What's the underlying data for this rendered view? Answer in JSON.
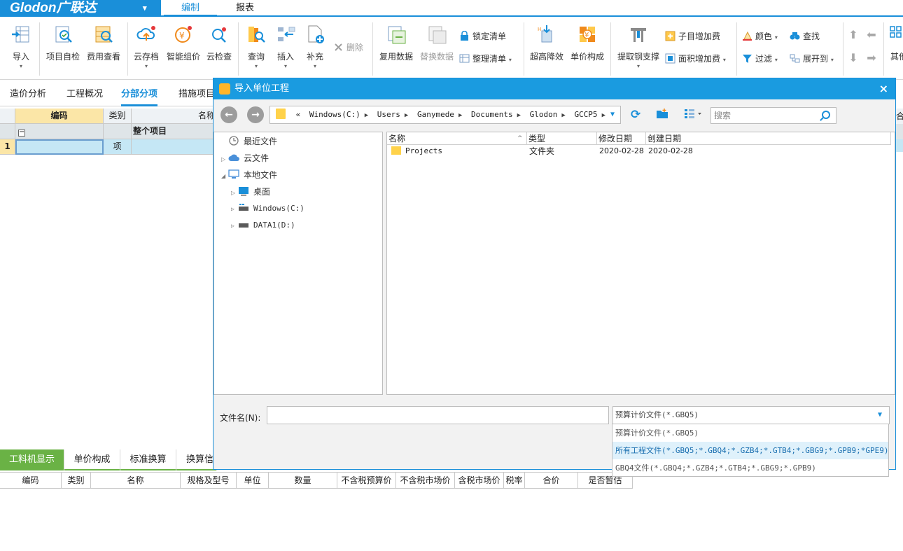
{
  "app": {
    "logo_text": "Glodon广联达",
    "logo_arrow": "▾"
  },
  "menu_tabs": [
    {
      "label": "编制",
      "active": true
    },
    {
      "label": "报表",
      "active": false
    }
  ],
  "ribbon": {
    "groups": [
      {
        "label": "导入",
        "icon": "import-icon",
        "dropdown": true
      },
      {
        "label": "项目自检",
        "icon": "self-check-icon"
      },
      {
        "label": "费用查看",
        "icon": "fee-view-icon"
      },
      {
        "label": "云存档",
        "icon": "cloud-save-icon",
        "dropdown": true
      },
      {
        "label": "智能组价",
        "icon": "smart-pricing-icon"
      },
      {
        "label": "云检查",
        "icon": "cloud-check-icon"
      },
      {
        "label": "查询",
        "icon": "query-icon",
        "dropdown": true
      },
      {
        "label": "插入",
        "icon": "insert-icon",
        "dropdown": true
      },
      {
        "label": "补充",
        "icon": "supplement-icon",
        "dropdown": true
      },
      {
        "label": "复用数据",
        "icon": "reuse-data-icon"
      },
      {
        "label": "替换数据",
        "icon": "replace-data-icon",
        "disabled": true
      },
      {
        "label": "超高降效",
        "icon": "high-efficiency-icon"
      },
      {
        "label": "单价构成",
        "icon": "unit-price-icon"
      },
      {
        "label": "提取钢支撑",
        "icon": "steel-support-icon",
        "dropdown": true
      },
      {
        "label": "其他",
        "icon": "other-icon"
      }
    ],
    "small_buttons": [
      {
        "label": "删除",
        "icon": "delete-icon",
        "disabled": true
      },
      {
        "label": "锁定清单",
        "icon": "lock-icon"
      },
      {
        "label": "整理清单",
        "icon": "organize-icon",
        "dropdown": true
      },
      {
        "label": "子目增加费",
        "icon": "item-fee-icon"
      },
      {
        "label": "面积增加费",
        "icon": "area-fee-icon",
        "dropdown": true
      },
      {
        "label": "颜色",
        "icon": "color-icon",
        "dropdown": true
      },
      {
        "label": "查找",
        "icon": "find-icon"
      },
      {
        "label": "过滤",
        "icon": "filter-icon",
        "dropdown": true
      },
      {
        "label": "展开到",
        "icon": "expand-icon",
        "dropdown": true
      }
    ]
  },
  "sub_tabs": [
    {
      "label": "造价分析"
    },
    {
      "label": "工程概况"
    },
    {
      "label": "分部分项",
      "active": true
    },
    {
      "label": "措施项目"
    }
  ],
  "main_grid": {
    "headers": {
      "code": "编码",
      "type": "类别",
      "name": "名称"
    },
    "rows": [
      {
        "index": "",
        "code": "",
        "type": "",
        "name": "整个项目"
      },
      {
        "index": "1",
        "code": "",
        "type": "项",
        "name": ""
      }
    ],
    "right_edge_text": "合计"
  },
  "bottom_tabs": [
    {
      "label": "工料机显示",
      "active": true
    },
    {
      "label": "单价构成"
    },
    {
      "label": "标准换算"
    },
    {
      "label": "换算信息"
    }
  ],
  "bottom_headers": [
    "编码",
    "类别",
    "名称",
    "规格及型号",
    "单位",
    "数量",
    "不含税预算价",
    "不含税市场价",
    "含税市场价",
    "税率",
    "合价",
    "是否暂估"
  ],
  "dialog": {
    "title": "导入单位工程",
    "close": "×",
    "back": "←",
    "forward": "→",
    "address": {
      "prefix": "«",
      "crumbs": [
        "Windows(C:)",
        "Users",
        "Ganymede",
        "Documents",
        "Glodon",
        "GCCP5"
      ]
    },
    "search_placeholder": "搜索",
    "tree": [
      {
        "label": "最近文件",
        "icon": "recent-icon",
        "level": 0
      },
      {
        "label": "云文件",
        "icon": "cloud-icon",
        "level": 0,
        "arrow": "▷"
      },
      {
        "label": "本地文件",
        "icon": "computer-icon",
        "level": 0,
        "arrow": "◢"
      },
      {
        "label": "桌面",
        "icon": "desktop-icon",
        "level": 1,
        "arrow": "▷"
      },
      {
        "label": "Windows(C:)",
        "icon": "drive-c-icon",
        "level": 1,
        "arrow": "▷"
      },
      {
        "label": "DATA1(D:)",
        "icon": "drive-d-icon",
        "level": 1,
        "arrow": "▷"
      }
    ],
    "file_headers": {
      "name": "名称",
      "type": "类型",
      "modified": "修改日期",
      "created": "创建日期"
    },
    "files": [
      {
        "name": "Projects",
        "type": "文件夹",
        "modified": "2020-02-28",
        "created": "2020-02-28"
      }
    ],
    "filename_label": "文件名(N):",
    "filename_value": "",
    "filetype_selected": "预算计价文件(*.GBQ5)",
    "filetype_options": [
      "预算计价文件(*.GBQ5)",
      "所有工程文件(*.GBQ5;*.GBQ4;*.GZB4;*.GTB4;*.GBG9;*.GPB9;*GPE9)",
      "GBQ4文件(*.GBQ4;*.GZB4;*.GTB4;*.GBG9;*.GPB9)"
    ],
    "colors": {
      "accent": "#1a8fd9",
      "title_bar": "#1a9be0",
      "active_green": "#6ab245"
    }
  }
}
